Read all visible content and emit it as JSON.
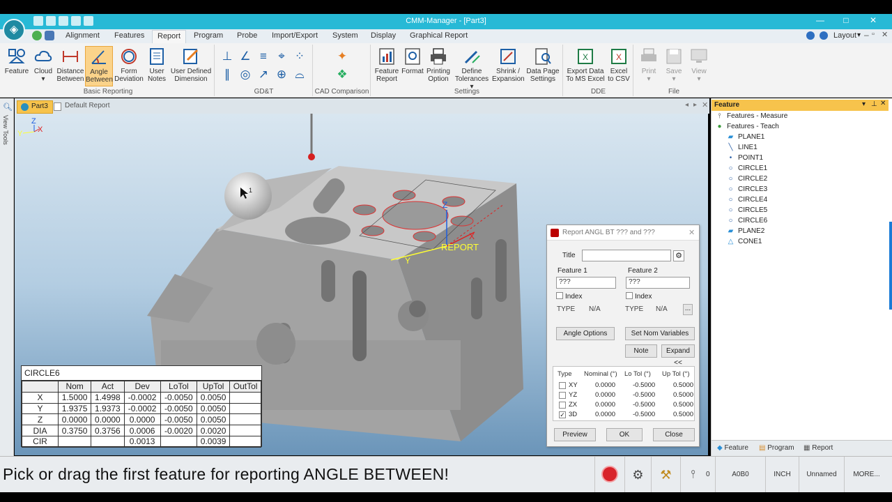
{
  "app": {
    "title": "CMM-Manager - [Part3]",
    "layout_label": "Layout",
    "accent_color": "#27b9d6"
  },
  "menu": {
    "items": [
      "Alignment",
      "Features",
      "Report",
      "Program",
      "Probe",
      "Import/Export",
      "System",
      "Display",
      "Graphical Report"
    ],
    "active": "Report"
  },
  "ribbon": {
    "basic_reporting": {
      "label": "Basic Reporting",
      "buttons": [
        {
          "l1": "Feature",
          "l2": ""
        },
        {
          "l1": "Cloud",
          "l2": "▾"
        },
        {
          "l1": "Distance",
          "l2": "Between"
        },
        {
          "l1": "Angle",
          "l2": "Between"
        },
        {
          "l1": "Form",
          "l2": "Deviation"
        },
        {
          "l1": "User",
          "l2": "Notes"
        },
        {
          "l1": "User Defined",
          "l2": "Dimension"
        }
      ]
    },
    "gdt": {
      "label": "GD&T"
    },
    "cad": {
      "label": "CAD Comparison"
    },
    "settings": {
      "label": "Settings",
      "buttons": [
        {
          "l1": "Feature",
          "l2": "Report"
        },
        {
          "l1": "Format",
          "l2": ""
        },
        {
          "l1": "Printing",
          "l2": "Option"
        },
        {
          "l1": "Define",
          "l2": "Tolerances ▾"
        },
        {
          "l1": "Shrink /",
          "l2": "Expansion"
        },
        {
          "l1": "Data Page",
          "l2": "Settings"
        }
      ]
    },
    "dde": {
      "label": "DDE",
      "buttons": [
        {
          "l1": "Export Data",
          "l2": "To MS Excel"
        },
        {
          "l1": "Excel",
          "l2": "to CSV"
        }
      ]
    },
    "file": {
      "label": "File",
      "buttons": [
        {
          "l1": "Print",
          "l2": "▾"
        },
        {
          "l1": "Save",
          "l2": "▾"
        },
        {
          "l1": "View",
          "l2": "▾"
        }
      ]
    }
  },
  "left_strip": {
    "label": "View Tools"
  },
  "doc_tabs": [
    "Part3",
    "Default Report"
  ],
  "viewport": {
    "axis_labels": {
      "z": "Z",
      "y": "Y",
      "x": "X"
    },
    "overlay_label": "REPORT",
    "marker_label": "1"
  },
  "result_table": {
    "caption": "CIRCLE6",
    "headers": [
      "",
      "Nom",
      "Act",
      "Dev",
      "LoTol",
      "UpTol",
      "OutTol"
    ],
    "rows": [
      [
        "X",
        "1.5000",
        "1.4998",
        "-0.0002",
        "-0.0050",
        "0.0050",
        ""
      ],
      [
        "Y",
        "1.9375",
        "1.9373",
        "-0.0002",
        "-0.0050",
        "0.0050",
        ""
      ],
      [
        "Z",
        "0.0000",
        "0.0000",
        "0.0000",
        "-0.0050",
        "0.0050",
        ""
      ],
      [
        "DIA",
        "0.3750",
        "0.3756",
        "0.0006",
        "-0.0020",
        "0.0020",
        ""
      ],
      [
        "CIR",
        "",
        "",
        "0.0013",
        "",
        "0.0039",
        ""
      ]
    ]
  },
  "dialog": {
    "title": "Report ANGL BT ??? and ???",
    "title_label": "Title",
    "title_value": "",
    "feature1_label": "Feature 1",
    "feature1_value": "???",
    "feature2_label": "Feature 2",
    "feature2_value": "???",
    "index_label": "Index",
    "type_label": "TYPE",
    "type1_value": "N/A",
    "type2_value": "N/A",
    "more_label": "...",
    "angle_options": "Angle Options",
    "set_nom": "Set Nom Variables",
    "note": "Note",
    "expand": "Expand <<",
    "tol_headers": [
      "Type",
      "Nominal (°)",
      "Lo Tol (°)",
      "Up Tol (°)"
    ],
    "tol_rows": [
      {
        "type": "XY",
        "nominal": "0.0000",
        "lo": "-0.5000",
        "up": "0.5000",
        "checked": false
      },
      {
        "type": "YZ",
        "nominal": "0.0000",
        "lo": "-0.5000",
        "up": "0.5000",
        "checked": false
      },
      {
        "type": "ZX",
        "nominal": "0.0000",
        "lo": "-0.5000",
        "up": "0.5000",
        "checked": false
      },
      {
        "type": "3D",
        "nominal": "0.0000",
        "lo": "-0.5000",
        "up": "0.5000",
        "checked": true
      }
    ],
    "preview": "Preview",
    "ok": "OK",
    "close": "Close"
  },
  "feature_panel": {
    "header": "Feature",
    "groups": [
      {
        "label": "Features - Measure",
        "icon": "probe-icon"
      },
      {
        "label": "Features - Teach",
        "icon": "globe-icon"
      }
    ],
    "items": [
      {
        "label": "PLANE1",
        "icon": "plane-icon"
      },
      {
        "label": "LINE1",
        "icon": "line-icon"
      },
      {
        "label": "POINT1",
        "icon": "point-icon"
      },
      {
        "label": "CIRCLE1",
        "icon": "circle-icon"
      },
      {
        "label": "CIRCLE2",
        "icon": "circle-icon"
      },
      {
        "label": "CIRCLE3",
        "icon": "circle-icon"
      },
      {
        "label": "CIRCLE4",
        "icon": "circle-icon"
      },
      {
        "label": "CIRCLE5",
        "icon": "circle-icon"
      },
      {
        "label": "CIRCLE6",
        "icon": "circle-icon"
      },
      {
        "label": "PLANE2",
        "icon": "plane-icon"
      },
      {
        "label": "CONE1",
        "icon": "cone-icon"
      }
    ],
    "bottom_tabs": [
      "Feature",
      "Program",
      "Report"
    ]
  },
  "status": {
    "message": "Pick or drag the first feature for reporting ANGLE BETWEEN!",
    "counter": "0",
    "probe": "A0B0",
    "units": "INCH",
    "name": "Unnamed",
    "more": "MORE..."
  }
}
